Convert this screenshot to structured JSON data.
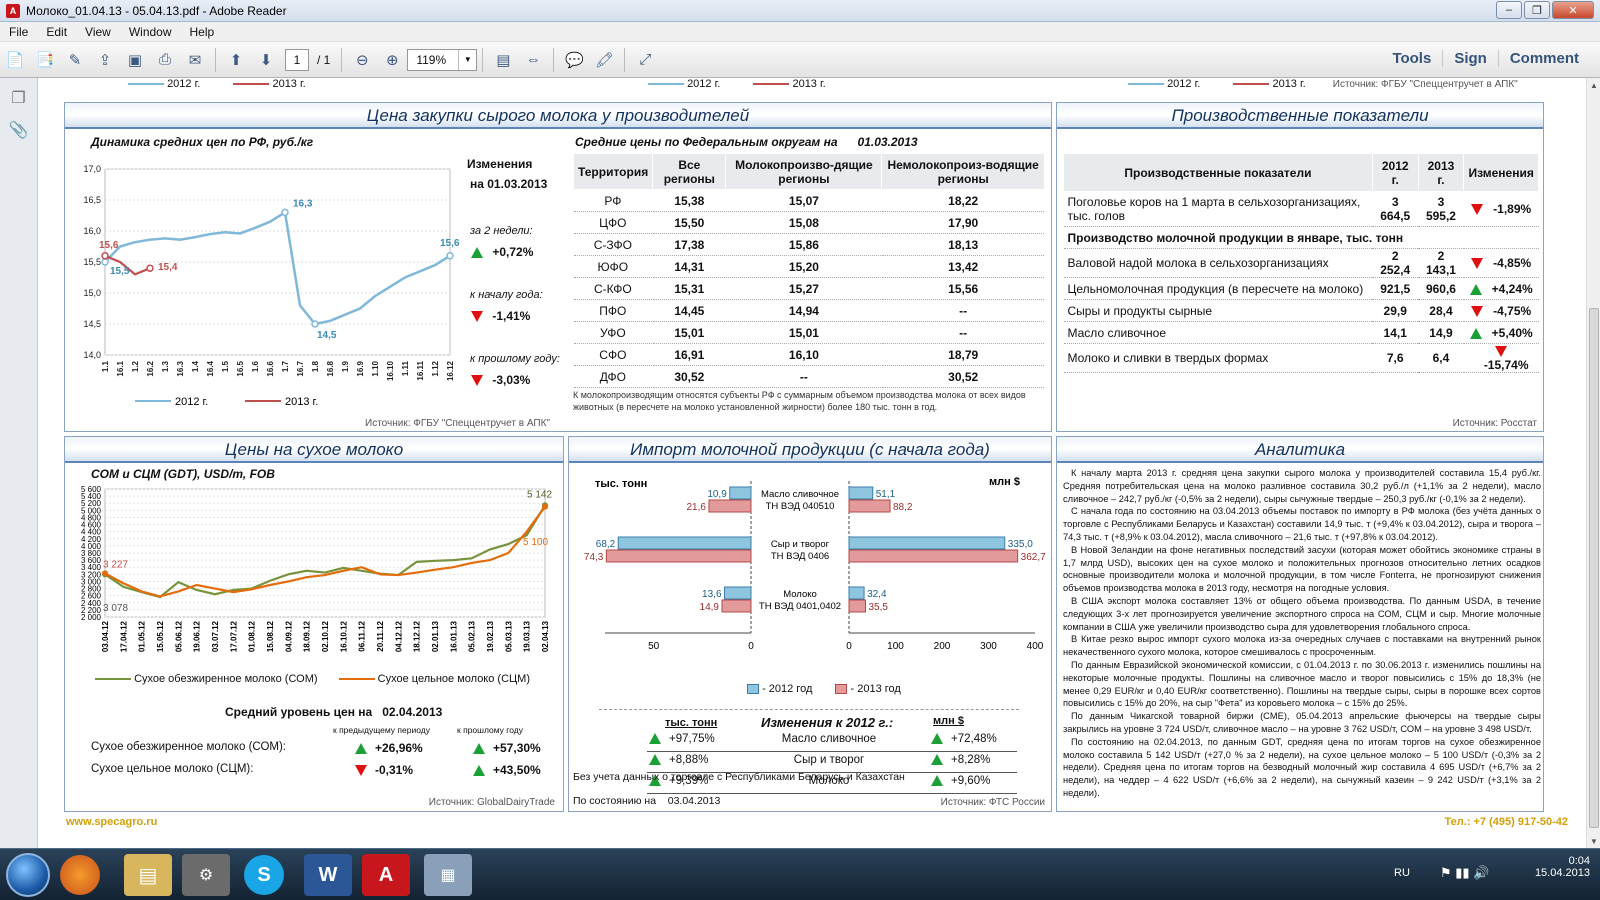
{
  "window": {
    "title": "Молоко_01.04.13 - 05.04.13.pdf - Adobe Reader"
  },
  "menu": [
    "File",
    "Edit",
    "View",
    "Window",
    "Help"
  ],
  "toolbar": {
    "page_current": "1",
    "page_total": "/ 1",
    "zoom": "119%",
    "right_links": [
      "Tools",
      "Sign",
      "Comment"
    ]
  },
  "top_strip": {
    "legend_a": "2012 г.",
    "legend_b": "2013 г.",
    "source": "Источник: ФГБУ \"Спеццентручет в АПК\""
  },
  "panel_price": {
    "title": "Цена закупки сырого молока у производителей",
    "chart_subtitle": "Динамика средних цен по РФ, руб./кг",
    "changes_title": "Изменения",
    "changes_date": "на  01.03.2013",
    "changes": [
      {
        "label": "за 2 недели:",
        "value": "+0,72%",
        "dir": "up"
      },
      {
        "label": "к началу года:",
        "value": "-1,41%",
        "dir": "down"
      },
      {
        "label": "к прошлому году:",
        "value": "-3,03%",
        "dir": "down"
      }
    ],
    "source": "Источник: ФГБУ \"Спеццентручет в АПК\"",
    "table_title": "Средние цены по Федеральным округам на",
    "table_date": "01.03.2013",
    "table_headers": [
      "Территория",
      "Все регионы",
      "Молокопроизво-дящие регионы",
      "Немолокопроиз-водящие регионы"
    ],
    "table_rows": [
      [
        "РФ",
        "15,38",
        "15,07",
        "18,22"
      ],
      [
        "ЦФО",
        "15,50",
        "15,08",
        "17,90"
      ],
      [
        "С-ЗФО",
        "17,38",
        "15,86",
        "18,13"
      ],
      [
        "ЮФО",
        "14,31",
        "15,20",
        "13,42"
      ],
      [
        "С-КФО",
        "15,31",
        "15,27",
        "15,56"
      ],
      [
        "ПФО",
        "14,45",
        "14,94",
        "--"
      ],
      [
        "УФО",
        "15,01",
        "15,01",
        "--"
      ],
      [
        "СФО",
        "16,91",
        "16,10",
        "18,79"
      ],
      [
        "ДФО",
        "30,52",
        "--",
        "30,52"
      ]
    ],
    "table_note": "К молокопроизводящим относятся субъекты РФ с суммарным объемом производства молока от всех видов животных (в пересчете на молоко установленной жирности) более 180 тыс. тонн в год."
  },
  "panel_prod": {
    "title": "Производственные показатели",
    "headers": [
      "Производственные показатели",
      "2012 г.",
      "2013 г.",
      "Изменения"
    ],
    "rows": [
      {
        "label": "Поголовье коров на 1 марта в сельхозорганизациях, тыс. голов",
        "y2012": "3 664,5",
        "y2013": "3 595,2",
        "chg": "-1,89%",
        "dir": "down"
      },
      {
        "section": "Производство молочной продукции в январе, тыс. тонн"
      },
      {
        "label": "Валовой надой молока в сельхозорганизациях",
        "y2012": "2 252,4",
        "y2013": "2 143,1",
        "chg": "-4,85%",
        "dir": "down"
      },
      {
        "label": "Цельномолочная продукция (в пересчете на молоко)",
        "y2012": "921,5",
        "y2013": "960,6",
        "chg": "+4,24%",
        "dir": "up"
      },
      {
        "label": "Сыры и продукты сырные",
        "y2012": "29,9",
        "y2013": "28,4",
        "chg": "-4,75%",
        "dir": "down"
      },
      {
        "label": "Масло сливочное",
        "y2012": "14,1",
        "y2013": "14,9",
        "chg": "+5,40%",
        "dir": "up"
      },
      {
        "label": "Молоко и сливки в твердых формах",
        "y2012": "7,6",
        "y2013": "6,4",
        "chg": "-15,74%",
        "dir": "down"
      }
    ],
    "source": "Источник: Росстат"
  },
  "panel_dry": {
    "title": "Цены на сухое молоко",
    "subtitle": "СОМ и СЦМ (GDT), USD/т, FOB",
    "legend_som": "Сухое обезжиренное молоко (СОМ)",
    "legend_scm": "Сухое цельное молоко (СЦМ)",
    "avg_title": "Средний уровень цен на",
    "avg_date": "02.04.2013",
    "col_prev": "к предыдущему периоду",
    "col_year": "к прошлому году",
    "rows": [
      {
        "label": "Сухое обезжиренное молоко (СОМ):",
        "prev": "+26,96%",
        "prev_dir": "up",
        "year": "+57,30%",
        "year_dir": "up"
      },
      {
        "label": "Сухое цельное молоко (СЦМ):",
        "prev": "-0,31%",
        "prev_dir": "down",
        "year": "+43,50%",
        "year_dir": "up"
      }
    ],
    "source": "Источник: GlobalDairyTrade"
  },
  "panel_import": {
    "title": "Импорт молочной продукции (с начала года)",
    "unit_left": "тыс. тонн",
    "unit_right": "млн $",
    "legend_2012": "- 2012 год",
    "legend_2013": "- 2013 год",
    "changes_unit_left": "тыс. тонн",
    "changes_title": "Изменения к 2012 г.:",
    "changes_unit_right": "млн $",
    "changes": [
      {
        "left": "+97,75%",
        "name": "Масло сливочное",
        "right": "+72,48%"
      },
      {
        "left": "+8,88%",
        "name": "Сыр и творог",
        "right": "+8,28%"
      },
      {
        "left": "+9,39%",
        "name": "Молоко",
        "right": "+9,60%"
      }
    ],
    "note": "Без учета данных о торговле с Республиками Беларусь и Казахстан",
    "asof_label": "По состоянию на",
    "asof_date": "03.04.2013",
    "source": "Источник: ФТС России"
  },
  "panel_analytics": {
    "title": "Аналитика",
    "paragraphs": [
      "К началу марта 2013 г. средняя цена закупки сырого молока у производителей составила 15,4 руб./кг. Средняя потребительская цена на молоко разливное составила 30,2 руб./л (+1,1% за 2 недели), масло сливочное – 242,7 руб./кг (-0,5% за 2 недели), сыры сычужные твердые – 250,3 руб./кг (-0,1% за 2 недели).",
      "С начала года по состоянию на 03.04.2013 объемы поставок по импорту в РФ молока (без учёта данных о торговле с Республиками Беларусь и Казахстан) составили 14,9 тыс. т (+9,4% к 03.04.2012), сыра и творога – 74,3 тыс. т (+8,9% к 03.04.2012), масла сливочного – 21,6 тыс. т (+97,8% к 03.04.2012).",
      "В Новой Зеландии на фоне негативных последствий засухи (которая может обойтись экономике страны в 1,7 млрд USD), высоких цен на сухое молоко и положительных прогнозов относительно летних осадков основные производители молока и молочной продукции, в том числе Fonterra, не прогнозируют снижения объемов производства молока в 2013 году, несмотря на погодные условия.",
      "В США экспорт молока составляет 13% от общего объема производства. По данным USDA, в течение следующих 3-х лет прогнозируется увеличение экспортного спроса на СОМ, СЦМ и сыр. Многие молочные компании в США уже увеличили производство сыра для удовлетворения глобального спроса.",
      "В Китае резко вырос импорт сухого молока из-за очередных случаев с поставками на внутренний рынок некачественного сухого молока, которое смешивалось с просроченным.",
      "По данным Евразийской экономической комиссии, с 01.04.2013 г. по 30.06.2013 г. изменились пошлины на некоторые молочные продукты. Пошлины на сливочное масло и творог повысились с 15% до 18,3% (не менее 0,29 EUR/кг и 0,40 EUR/кг соответственно). Пошлины на твердые сыры, сыры в порошке всех сортов повысились с 15% до 20%, на сыр \"Фета\" из коровьего молока – с 15% до 25%.",
      "По данным Чикагской товарной биржи (CME), 05.04.2013 апрельские фьючерсы на твердые сыры закрылись на уровне 3 724 USD/т, сливочное масло – на уровне 3 762 USD/т, СОМ – на уровне 3 498 USD/т.",
      "По состоянию на 02.04.2013, по данным GDT, средняя цена по итогам торгов на сухое обезжиренное молоко составила 5 142 USD/т (+27,0 % за 2 недели), на сухое цельное молоко – 5 100 USD/т (-0,3% за 2 недели). Средняя цена по итогам торгов на безводный молочный жир составила 4 695 USD/т (+6,7% за 2 недели), на чеддер – 4 622 USD/т (+6,6% за 2 недели), на сычужный казеин – 9 242 USD/т (+3,1% за 2 недели)."
    ]
  },
  "footer": {
    "site": "www.specagro.ru",
    "phone": "Тел.: +7 (495) 917-50-42"
  },
  "taskbar": {
    "lang": "RU",
    "time": "0:04",
    "date": "15.04.2013"
  },
  "chart_data": [
    {
      "type": "line",
      "title": "Динамика средних цен по РФ, руб./кг",
      "x": [
        "1.1",
        "16.1",
        "1.2",
        "16.2",
        "1.3",
        "16.3",
        "1.4",
        "16.4",
        "1.5",
        "16.5",
        "1.6",
        "16.6",
        "1.7",
        "16.7",
        "1.8",
        "16.8",
        "1.9",
        "16.9",
        "1.10",
        "16.10",
        "1.11",
        "16.11",
        "1.12",
        "16.12"
      ],
      "ylim": [
        14.0,
        17.0
      ],
      "yticks": [
        "17,0",
        "16,5",
        "16,0",
        "15,5",
        "15,0",
        "14,5",
        "14,0"
      ],
      "series": [
        {
          "name": "2012 г.",
          "color": "#7fb8d8",
          "values": [
            15.5,
            15.75,
            15.82,
            15.86,
            15.88,
            15.86,
            15.9,
            15.95,
            15.98,
            15.96,
            16.05,
            16.15,
            16.3,
            14.8,
            14.5,
            14.55,
            14.65,
            14.75,
            14.95,
            15.1,
            15.25,
            15.35,
            15.45,
            15.6
          ]
        },
        {
          "name": "2013 г.",
          "color": "#c0504d",
          "values": [
            15.6,
            15.5,
            15.3,
            15.4
          ]
        }
      ],
      "labels": [
        {
          "text": "16,3"
        },
        {
          "text": "14,5"
        },
        {
          "text": "15,6"
        },
        {
          "text": "15,5"
        },
        {
          "text": "15,6"
        },
        {
          "text": "15,4"
        }
      ]
    },
    {
      "type": "line",
      "title": "СОМ и СЦМ (GDT), USD/т, FOB",
      "x": [
        "03.04.12",
        "17.04.12",
        "01.05.12",
        "15.05.12",
        "05.06.12",
        "19.06.12",
        "03.07.12",
        "17.07.12",
        "01.08.12",
        "15.08.12",
        "04.09.12",
        "18.09.12",
        "02.10.12",
        "16.10.12",
        "06.11.12",
        "20.11.12",
        "04.12.12",
        "18.12.12",
        "02.01.13",
        "16.01.13",
        "05.02.13",
        "19.02.13",
        "05.03.13",
        "19.03.13",
        "02.04.13"
      ],
      "ylim": [
        2000,
        5600
      ],
      "yticks": [
        "5 600",
        "5 400",
        "5 200",
        "5 000",
        "4 800",
        "4 600",
        "4 400",
        "4 200",
        "4 000",
        "3 800",
        "3 600",
        "3 400",
        "3 200",
        "3 000",
        "2 800",
        "2 600",
        "2 400",
        "2 200",
        "2 000"
      ],
      "series": [
        {
          "name": "Сухое обезжиренное молоко (СОМ)",
          "color": "#77933c",
          "values": [
            3200,
            2850,
            2700,
            2560,
            2980,
            2760,
            2640,
            2760,
            2800,
            3020,
            3200,
            3300,
            3250,
            3380,
            3300,
            3220,
            3180,
            3550,
            3580,
            3600,
            3650,
            3900,
            4050,
            4300,
            5142
          ]
        },
        {
          "name": "Сухое цельное молоко (СЦМ)",
          "color": "#e46c0a",
          "values": [
            3227,
            2950,
            2720,
            2580,
            2720,
            2900,
            2800,
            2700,
            2780,
            2900,
            3000,
            3120,
            3180,
            3300,
            3400,
            3200,
            3180,
            3250,
            3330,
            3400,
            3520,
            3600,
            3800,
            4400,
            5100
          ]
        }
      ],
      "labels": [
        {
          "text": "3 227"
        },
        {
          "text": "3 078"
        },
        {
          "text": "5 142"
        },
        {
          "text": "5 100"
        }
      ]
    },
    {
      "type": "bar",
      "title": "Импорт молочной продукции (с начала года)",
      "categories": [
        "Масло сливочное ТН ВЭД 040510",
        "Сыр и творог ТН ВЭД 0406",
        "Молоко ТН ВЭД 0401,0402"
      ],
      "left_axis": {
        "unit": "тыс. тонн",
        "ticks": [
          "50",
          "0"
        ],
        "max": 75
      },
      "right_axis": {
        "unit": "млн $",
        "ticks": [
          "0",
          "100",
          "200",
          "300",
          "400"
        ],
        "max": 400
      },
      "series": [
        {
          "name": "- 2012 год",
          "color": "#8ec6df",
          "tonnes": [
            10.9,
            68.2,
            13.6
          ],
          "usd": [
            51.1,
            335.0,
            32.4
          ]
        },
        {
          "name": "- 2013 год",
          "color": "#e39a9a",
          "tonnes": [
            21.6,
            74.3,
            14.9
          ],
          "usd": [
            88.2,
            362.7,
            35.5
          ]
        }
      ],
      "value_labels": {
        "tonnes_2012": [
          "10,9",
          "68,2",
          "13,6"
        ],
        "tonnes_2013": [
          "21,6",
          "74,3",
          "14,9"
        ],
        "usd_2012": [
          "51,1",
          "335,0",
          "32,4"
        ],
        "usd_2013": [
          "88,2",
          "362,7",
          "35,5"
        ]
      },
      "category_lines": [
        [
          "Масло сливочное",
          "ТН ВЭД 040510"
        ],
        [
          "Сыр и творог",
          "ТН ВЭД 0406"
        ],
        [
          "Молоко",
          "ТН ВЭД 0401,0402"
        ]
      ]
    }
  ]
}
